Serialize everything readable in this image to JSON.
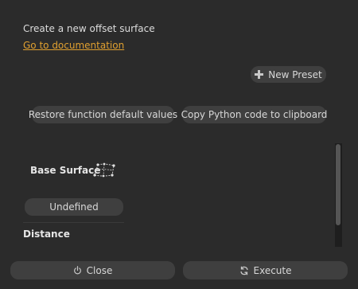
{
  "panel": {
    "description": "Create a new offset surface",
    "doc_link": "Go to documentation"
  },
  "toolbar": {
    "new_preset": "New Preset",
    "restore_defaults": "Restore function default values",
    "copy_python": "Copy Python code to clipboard"
  },
  "params": {
    "base_surface_label": "Base Surface",
    "base_surface_value": "Undefined",
    "distance_label": "Distance"
  },
  "footer": {
    "close": "Close",
    "execute": "Execute"
  },
  "colors": {
    "background": "#2b2b2b",
    "button": "#3f3f3f",
    "link": "#e0a030"
  }
}
